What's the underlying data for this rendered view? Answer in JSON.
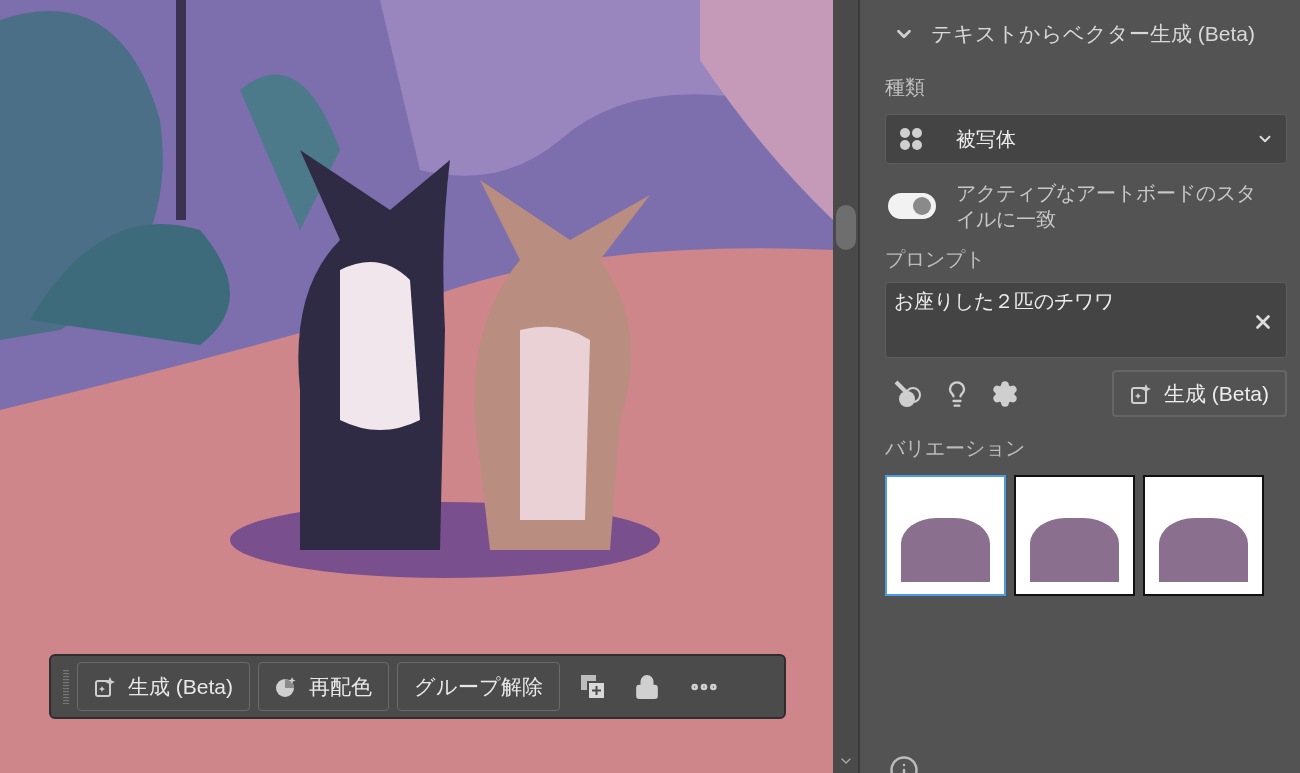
{
  "toolbar": {
    "buttons": [
      {
        "kind": "generate",
        "label": "生成 (Beta)"
      },
      {
        "kind": "recolor",
        "label": "再配色"
      },
      {
        "kind": "plain",
        "label": "グループ解除"
      }
    ]
  },
  "panel": {
    "title": "テキストからベクター生成 (Beta)",
    "expanded": true,
    "type_label": "種類",
    "type_value": "被写体",
    "match_style": {
      "label": "アクティブなアートボードのスタイルに一致",
      "on": true
    },
    "prompt_label": "プロンプト",
    "prompt_value": "お座りした２匹のチワワ",
    "generate_button": "生成 (Beta)",
    "variations_label": "バリエーション",
    "variations": [
      {
        "selected": true
      },
      {
        "selected": false
      },
      {
        "selected": false
      }
    ]
  }
}
